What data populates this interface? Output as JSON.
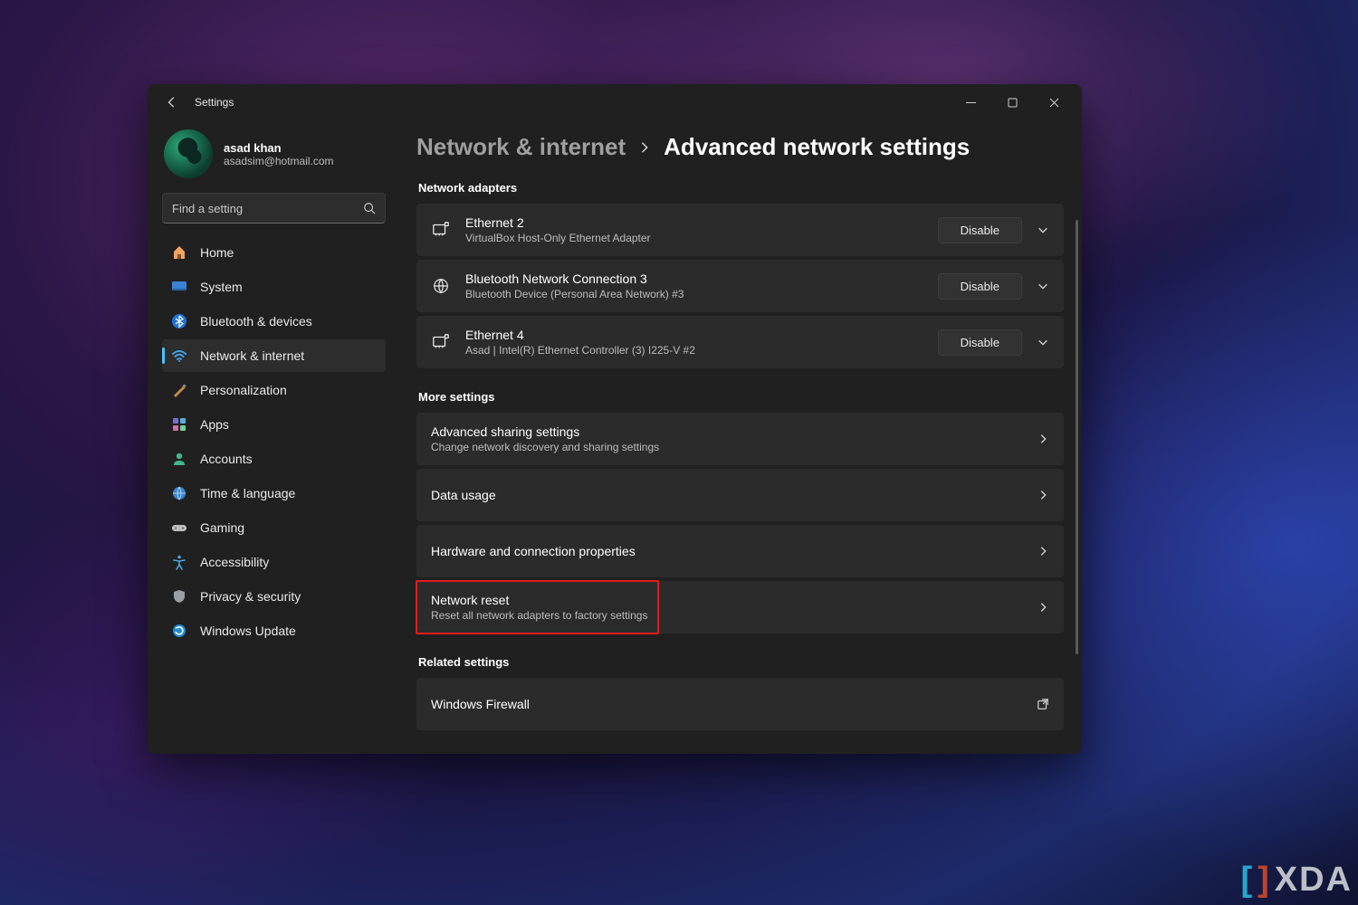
{
  "window": {
    "title": "Settings"
  },
  "profile": {
    "name": "asad khan",
    "email": "asadsim@hotmail.com"
  },
  "search": {
    "placeholder": "Find a setting"
  },
  "nav": [
    {
      "label": "Home"
    },
    {
      "label": "System"
    },
    {
      "label": "Bluetooth & devices"
    },
    {
      "label": "Network & internet"
    },
    {
      "label": "Personalization"
    },
    {
      "label": "Apps"
    },
    {
      "label": "Accounts"
    },
    {
      "label": "Time & language"
    },
    {
      "label": "Gaming"
    },
    {
      "label": "Accessibility"
    },
    {
      "label": "Privacy & security"
    },
    {
      "label": "Windows Update"
    }
  ],
  "breadcrumb": {
    "parent": "Network & internet",
    "current": "Advanced network settings"
  },
  "sections": {
    "adapters_title": "Network adapters",
    "more_title": "More settings",
    "related_title": "Related settings"
  },
  "adapters": [
    {
      "title": "Ethernet 2",
      "sub": "VirtualBox Host-Only Ethernet Adapter",
      "button": "Disable"
    },
    {
      "title": "Bluetooth Network Connection 3",
      "sub": "Bluetooth Device (Personal Area Network) #3",
      "button": "Disable"
    },
    {
      "title": "Ethernet 4",
      "sub": "Asad | Intel(R) Ethernet Controller (3) I225-V #2",
      "button": "Disable"
    }
  ],
  "more": [
    {
      "title": "Advanced sharing settings",
      "sub": "Change network discovery and sharing settings"
    },
    {
      "title": "Data usage",
      "sub": ""
    },
    {
      "title": "Hardware and connection properties",
      "sub": ""
    },
    {
      "title": "Network reset",
      "sub": "Reset all network adapters to factory settings"
    }
  ],
  "related": [
    {
      "title": "Windows Firewall"
    }
  ],
  "watermark": "XDA"
}
